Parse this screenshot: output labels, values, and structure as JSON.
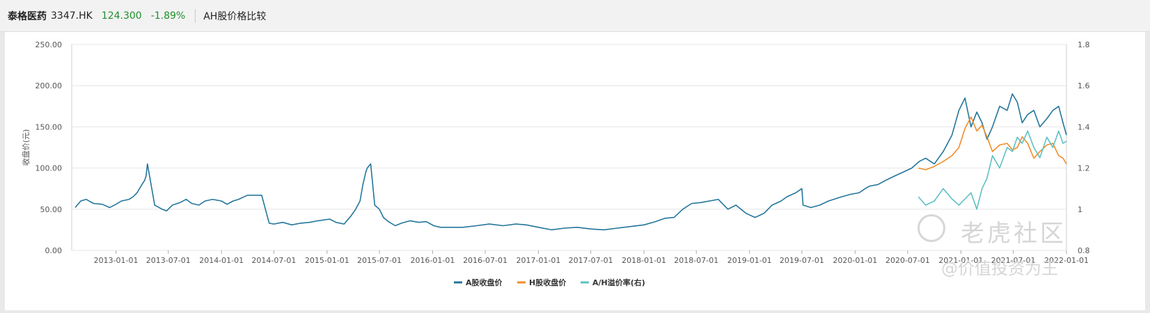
{
  "header": {
    "name": "泰格医药",
    "code": "3347.HK",
    "price": "124.300",
    "change": "-1.89%",
    "title": "AH股价格比较"
  },
  "watermark": {
    "line1": "老虎社区",
    "line2": "@价值投资为王"
  },
  "colors": {
    "a_share": "#23759b",
    "h_share": "#f28c28",
    "ah_premium": "#5ec0c4",
    "header_up_down": "#1f8f2a"
  },
  "chart_data": {
    "type": "line",
    "title": "",
    "xlabel": "",
    "ylabel": "收盘价(元)",
    "ylim": [
      0,
      250
    ],
    "y2lim": [
      0.8,
      1.8
    ],
    "yticks": [
      "0.00",
      "50.00",
      "100.00",
      "150.00",
      "200.00",
      "250.00"
    ],
    "y2ticks": [
      "0.8",
      "1",
      "1.2",
      "1.4",
      "1.6",
      "1.8"
    ],
    "xlim": [
      "2012-08-01",
      "2022-01-01"
    ],
    "xticks": [
      "2013-01-01",
      "2013-07-01",
      "2014-01-01",
      "2014-07-01",
      "2015-01-01",
      "2015-07-01",
      "2016-01-01",
      "2016-07-01",
      "2017-01-01",
      "2017-07-01",
      "2018-01-01",
      "2018-07-01",
      "2019-01-01",
      "2019-07-01",
      "2020-01-01",
      "2020-07-01",
      "2021-01-01",
      "2021-07-01",
      "2022-01-01"
    ],
    "legend_position": "bottom-center",
    "grid": true,
    "series": [
      {
        "name": "A股收盘价",
        "axis": "left",
        "x": [
          "2012-08-13",
          "2012-09-01",
          "2012-09-20",
          "2012-10-15",
          "2012-11-15",
          "2012-12-10",
          "2013-01-01",
          "2013-01-20",
          "2013-02-15",
          "2013-03-01",
          "2013-03-15",
          "2013-04-01",
          "2013-04-10",
          "2013-04-15",
          "2013-04-20",
          "2013-05-15",
          "2013-06-10",
          "2013-06-25",
          "2013-07-15",
          "2013-08-10",
          "2013-09-01",
          "2013-09-20",
          "2013-10-15",
          "2013-11-05",
          "2013-12-01",
          "2014-01-01",
          "2014-01-20",
          "2014-02-10",
          "2014-03-01",
          "2014-04-01",
          "2014-04-25",
          "2014-05-01",
          "2014-05-20",
          "2014-06-15",
          "2014-07-01",
          "2014-08-01",
          "2014-09-01",
          "2014-10-01",
          "2014-11-01",
          "2014-12-01",
          "2015-01-10",
          "2015-02-01",
          "2015-03-01",
          "2015-03-25",
          "2015-04-10",
          "2015-04-25",
          "2015-05-05",
          "2015-05-15",
          "2015-05-20",
          "2015-06-01",
          "2015-06-15",
          "2015-07-01",
          "2015-07-15",
          "2015-08-01",
          "2015-08-25",
          "2015-09-15",
          "2015-10-15",
          "2015-11-15",
          "2015-12-10",
          "2016-01-05",
          "2016-01-28",
          "2016-03-01",
          "2016-04-15",
          "2016-06-01",
          "2016-07-15",
          "2016-09-01",
          "2016-10-15",
          "2016-11-20",
          "2017-01-01",
          "2017-02-15",
          "2017-04-01",
          "2017-05-15",
          "2017-07-01",
          "2017-08-15",
          "2017-10-01",
          "2017-11-15",
          "2018-01-01",
          "2018-02-10",
          "2018-03-15",
          "2018-04-15",
          "2018-05-15",
          "2018-06-15",
          "2018-07-15",
          "2018-08-15",
          "2018-09-15",
          "2018-10-18",
          "2018-11-15",
          "2018-12-20",
          "2019-01-20",
          "2019-02-20",
          "2019-03-20",
          "2019-04-20",
          "2019-05-10",
          "2019-06-10",
          "2019-07-01",
          "2019-07-05",
          "2019-08-01",
          "2019-09-01",
          "2019-10-01",
          "2019-11-15",
          "2019-12-15",
          "2020-01-15",
          "2020-02-05",
          "2020-02-20",
          "2020-03-20",
          "2020-04-15",
          "2020-05-15",
          "2020-06-15",
          "2020-07-15",
          "2020-08-10",
          "2020-09-01",
          "2020-10-01",
          "2020-11-01",
          "2020-12-01",
          "2020-12-25",
          "2021-01-15",
          "2021-02-05",
          "2021-02-25",
          "2021-03-15",
          "2021-04-01",
          "2021-04-20",
          "2021-05-15",
          "2021-06-10",
          "2021-06-28",
          "2021-07-15",
          "2021-08-01",
          "2021-08-20",
          "2021-09-10",
          "2021-10-01",
          "2021-10-25",
          "2021-11-15",
          "2021-12-05",
          "2021-12-20",
          "2022-01-01"
        ],
        "values": [
          52,
          60,
          62,
          57,
          56,
          52,
          56,
          60,
          62,
          65,
          70,
          80,
          85,
          90,
          105,
          55,
          50,
          48,
          55,
          58,
          62,
          57,
          55,
          60,
          62,
          60,
          56,
          60,
          62,
          67,
          67,
          67,
          67,
          33,
          32,
          34,
          31,
          33,
          34,
          36,
          38,
          34,
          32,
          42,
          50,
          60,
          80,
          95,
          100,
          105,
          55,
          50,
          40,
          35,
          30,
          33,
          36,
          34,
          35,
          30,
          28,
          28,
          28,
          30,
          32,
          30,
          32,
          31,
          28,
          25,
          27,
          28,
          26,
          25,
          27,
          29,
          31,
          35,
          39,
          40,
          50,
          57,
          58,
          60,
          62,
          50,
          55,
          45,
          40,
          45,
          55,
          60,
          65,
          70,
          75,
          55,
          52,
          55,
          60,
          65,
          68,
          70,
          75,
          78,
          80,
          85,
          90,
          95,
          100,
          108,
          112,
          105,
          120,
          140,
          170,
          185,
          150,
          168,
          155,
          135,
          150,
          175,
          170,
          190,
          180,
          155,
          165,
          170,
          150,
          160,
          170,
          175,
          155,
          140
        ]
      },
      {
        "name": "H股收盘价",
        "axis": "left",
        "x": [
          "2020-08-07",
          "2020-09-01",
          "2020-10-01",
          "2020-11-01",
          "2020-12-01",
          "2020-12-25",
          "2021-01-15",
          "2021-02-05",
          "2021-02-25",
          "2021-03-15",
          "2021-04-01",
          "2021-04-20",
          "2021-05-15",
          "2021-06-10",
          "2021-06-28",
          "2021-07-15",
          "2021-08-01",
          "2021-08-20",
          "2021-09-10",
          "2021-10-01",
          "2021-10-25",
          "2021-11-15",
          "2021-12-05",
          "2021-12-20",
          "2022-01-01"
        ],
        "values": [
          100,
          98,
          102,
          108,
          115,
          125,
          148,
          162,
          145,
          152,
          138,
          120,
          128,
          130,
          122,
          125,
          138,
          130,
          112,
          120,
          128,
          130,
          115,
          112,
          105
        ]
      },
      {
        "name": "A/H溢价率(右)",
        "axis": "right",
        "x": [
          "2020-08-07",
          "2020-09-01",
          "2020-10-01",
          "2020-11-01",
          "2020-12-01",
          "2020-12-25",
          "2021-01-15",
          "2021-02-05",
          "2021-02-25",
          "2021-03-15",
          "2021-04-01",
          "2021-04-20",
          "2021-05-15",
          "2021-06-10",
          "2021-06-28",
          "2021-07-15",
          "2021-08-01",
          "2021-08-20",
          "2021-09-10",
          "2021-10-01",
          "2021-10-25",
          "2021-11-15",
          "2021-12-05",
          "2021-12-20",
          "2022-01-01"
        ],
        "values": [
          1.06,
          1.02,
          1.04,
          1.1,
          1.05,
          1.02,
          1.05,
          1.08,
          1.0,
          1.1,
          1.15,
          1.26,
          1.2,
          1.3,
          1.28,
          1.35,
          1.32,
          1.38,
          1.3,
          1.25,
          1.35,
          1.3,
          1.38,
          1.32,
          1.33
        ]
      }
    ]
  }
}
